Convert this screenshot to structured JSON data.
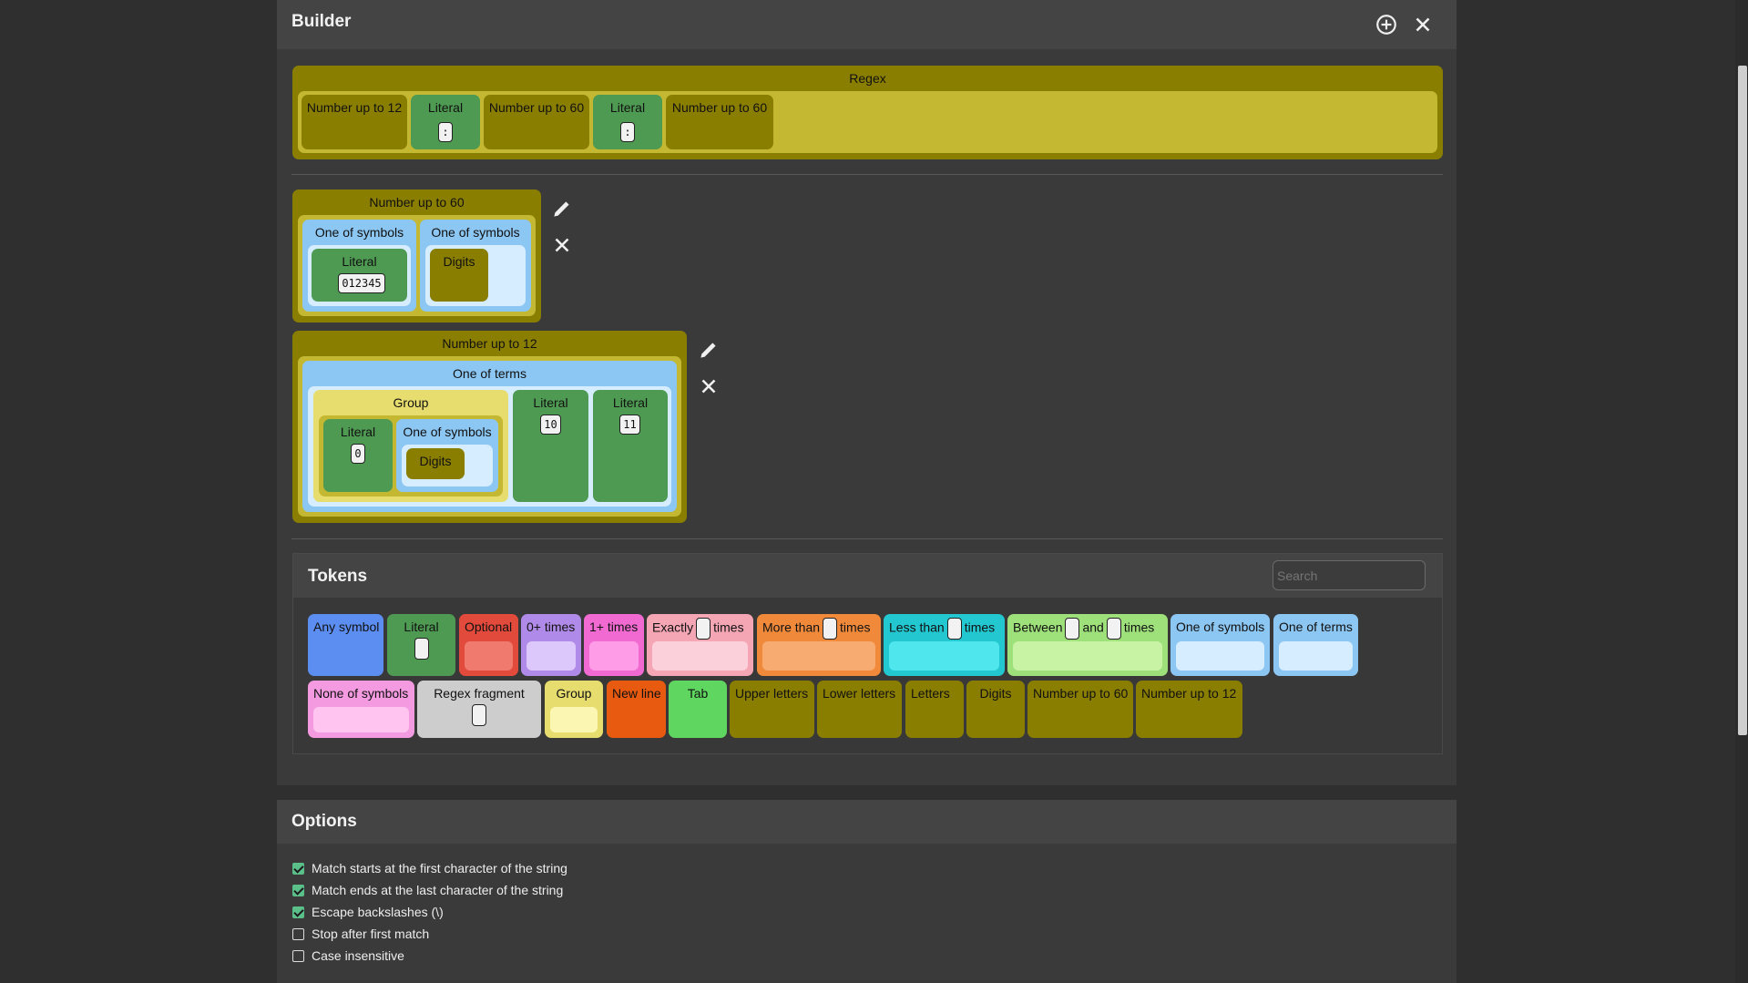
{
  "builder": {
    "title": "Builder",
    "regex": {
      "title": "Regex",
      "items": [
        {
          "label": "Number up to 12"
        },
        {
          "label": "Literal",
          "value": ":"
        },
        {
          "label": "Number up to 60"
        },
        {
          "label": "Literal",
          "value": ":"
        },
        {
          "label": "Number up to 60"
        }
      ]
    },
    "def60": {
      "title": "Number up to 60",
      "sym1": "One of symbols",
      "lit_label": "Literal",
      "lit_value": "012345",
      "sym2": "One of symbols",
      "digits": "Digits"
    },
    "def12": {
      "title": "Number up to 12",
      "terms": "One of terms",
      "group": "Group",
      "lit0_label": "Literal",
      "lit0_value": "0",
      "sym": "One of symbols",
      "digits": "Digits",
      "lit10_label": "Literal",
      "lit10_value": "10",
      "lit11_label": "Literal",
      "lit11_value": "11"
    }
  },
  "tokens": {
    "title": "Tokens",
    "search_placeholder": "Search",
    "items": [
      {
        "label": "Any symbol",
        "color": "#5b8ef0"
      },
      {
        "label": "Literal",
        "color": "#4e9a52"
      },
      {
        "label": "Optional",
        "color": "#e24a3c",
        "inner": "#f07a6e"
      },
      {
        "label": "0+ times",
        "color": "#b08ae8",
        "inner": "#dcc8fb"
      },
      {
        "label": "1+ times",
        "color": "#f06ad2",
        "inner": "#ff9ce8"
      },
      {
        "label_a": "Exactly",
        "label_b": "times",
        "color": "#f5a6b4",
        "inner": "#fcd0da"
      },
      {
        "label_a": "More than",
        "label_b": "times",
        "color": "#f08a3a",
        "inner": "#f7ab70"
      },
      {
        "label_a": "Less than",
        "label_b": "times",
        "color": "#22c7d0",
        "inner": "#4fe6ee"
      },
      {
        "label_a": "Between",
        "label_m": "and",
        "label_b": "times",
        "color": "#9ee07a",
        "inner": "#c8f3a4"
      },
      {
        "label": "One of symbols",
        "color": "#8cc6f2",
        "inner": "#d6ecff"
      },
      {
        "label": "One of terms",
        "color": "#8cc6f2",
        "inner": "#d6ecff"
      },
      {
        "label": "None of symbols",
        "color": "#f39ae0",
        "inner": "#ffc4f0"
      },
      {
        "label": "Regex fragment",
        "color": "#cdcdcd"
      },
      {
        "label": "Group",
        "color": "#e6dd6e",
        "inner": "#fbf7b3"
      },
      {
        "label": "New line",
        "color": "#e85a10"
      },
      {
        "label": "Tab",
        "color": "#5fd65f"
      },
      {
        "label": "Upper letters",
        "color": "#8a7e00"
      },
      {
        "label": "Lower letters",
        "color": "#8a7e00"
      },
      {
        "label": "Letters",
        "color": "#8a7e00"
      },
      {
        "label": "Digits",
        "color": "#8a7e00"
      },
      {
        "label": "Number up to 60",
        "color": "#8a7e00"
      },
      {
        "label": "Number up to 12",
        "color": "#8a7e00"
      }
    ]
  },
  "options": {
    "title": "Options",
    "items": [
      {
        "label": "Match starts at the first character of the string",
        "checked": true
      },
      {
        "label": "Match ends at the last character of the string",
        "checked": true
      },
      {
        "label": "Escape backslashes (\\)",
        "checked": true
      },
      {
        "label": "Stop after first match",
        "checked": false
      },
      {
        "label": "Case insensitive",
        "checked": false
      }
    ]
  },
  "icons": {
    "add": "plus-circle-icon",
    "close": "close-icon",
    "edit": "pencil-icon",
    "delete": "close-icon"
  }
}
